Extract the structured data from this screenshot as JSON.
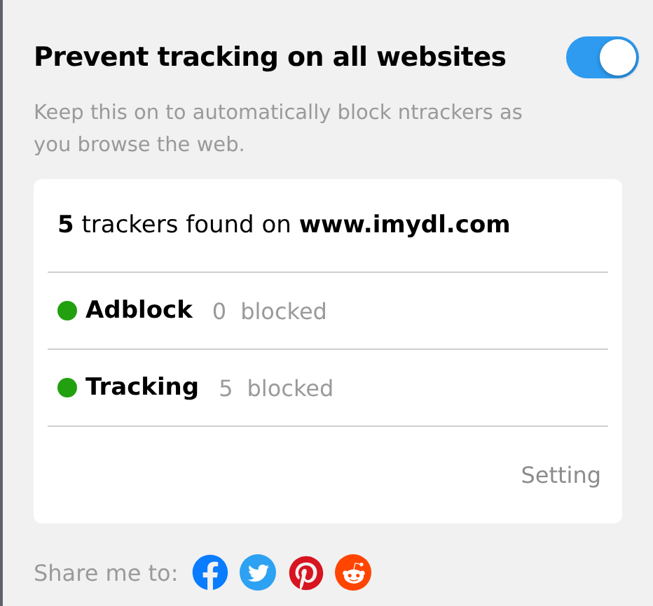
{
  "header": {
    "title": "Prevent tracking on all websites",
    "toggle": {
      "on": true
    },
    "description": "Keep this on to automatically block ntrackers as you browse the web."
  },
  "card": {
    "summary": "**5** trackers found on **www.imydl.com**",
    "rows": [
      {
        "name": "Adblock",
        "count": "0",
        "unit": "blocked",
        "color": "#22a00f"
      },
      {
        "name": "Tracking",
        "count": "5",
        "unit": "blocked",
        "color": "#22a00f"
      }
    ],
    "link": "Setting"
  },
  "share": {
    "label": "Share me to:",
    "targets": [
      {
        "kind": "facebook",
        "color": "#0a7cff"
      },
      {
        "kind": "twitter",
        "color": "#2da1f2"
      },
      {
        "kind": "pinterest",
        "color": "#d7141f"
      },
      {
        "kind": "reddit",
        "color": "#ff4500"
      }
    ]
  }
}
